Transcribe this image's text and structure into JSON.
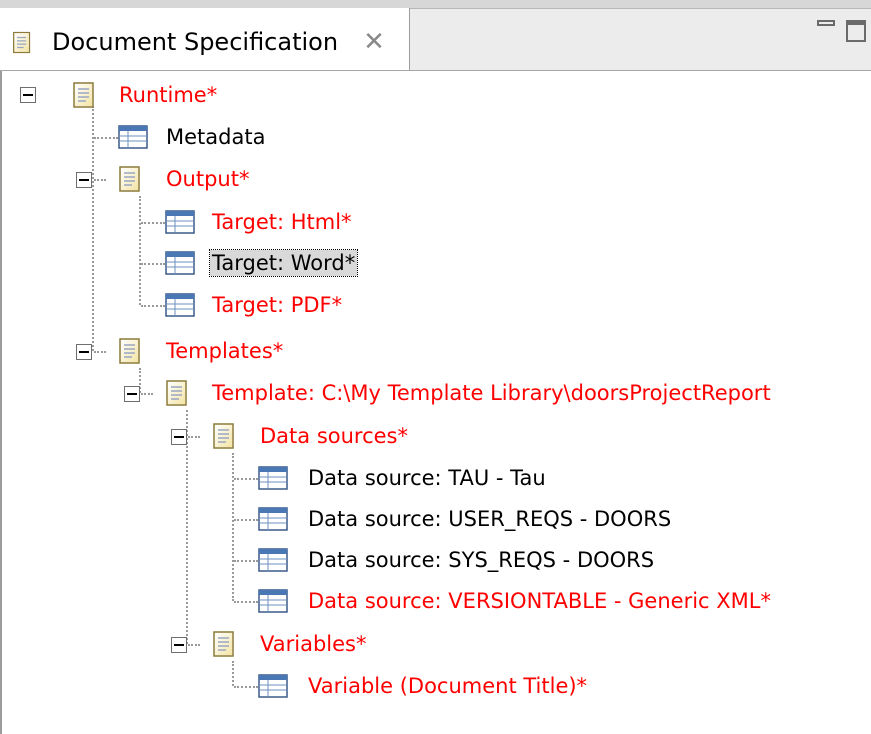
{
  "tab": {
    "title": "Document Specification",
    "close": "✕"
  },
  "colors": {
    "modified": "#ff0000",
    "normal": "#000000",
    "selected_bg": "#d9d9d9"
  },
  "tree": {
    "runtime": "Runtime*",
    "metadata": "Metadata",
    "output": "Output*",
    "target_html": "Target: Html*",
    "target_word": "Target: Word*",
    "target_pdf": "Target: PDF*",
    "templates": "Templates*",
    "template_path": "Template: C:\\My Template Library\\doorsProjectReport",
    "data_sources": "Data sources*",
    "ds_tau": "Data source: TAU - Tau",
    "ds_user_reqs": "Data source: USER_REQS - DOORS",
    "ds_sys_reqs": "Data source: SYS_REQS - DOORS",
    "ds_versiontable": "Data source: VERSIONTABLE - Generic XML*",
    "variables": "Variables*",
    "variable_title": "Variable (Document Title)*"
  }
}
